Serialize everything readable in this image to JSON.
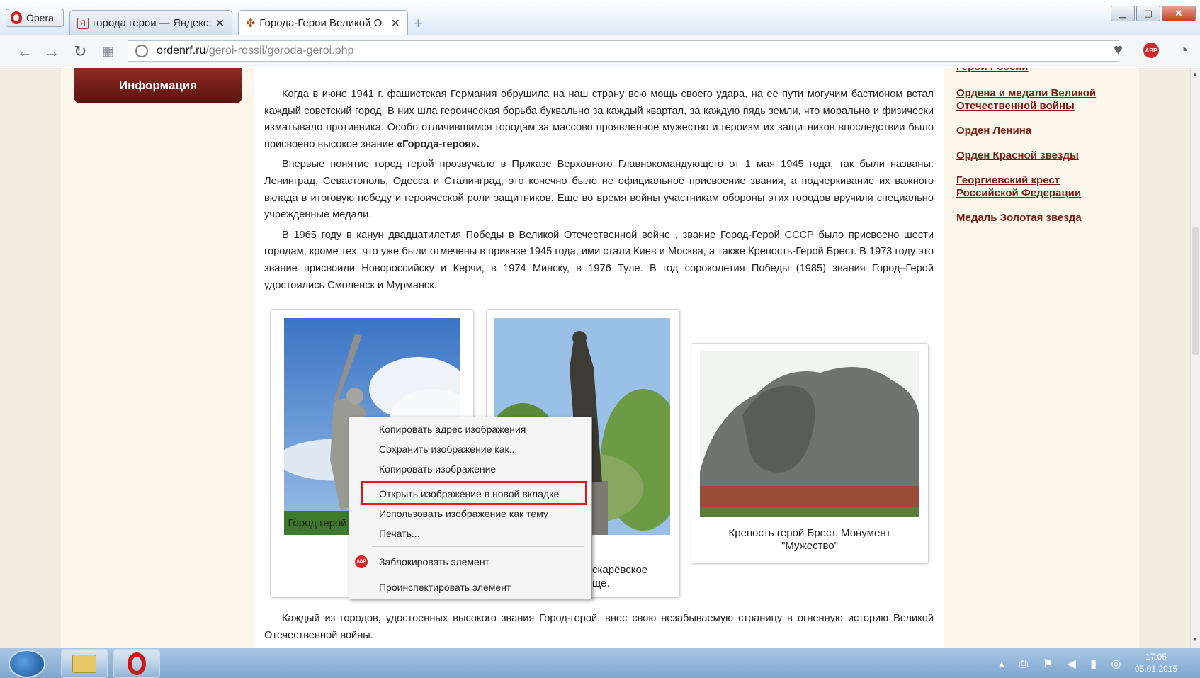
{
  "browser": {
    "menu_label": "Opera",
    "tabs": [
      {
        "title": "города герои — Яндекс: н",
        "favicon": "Я"
      },
      {
        "title": "Города-Герои Великой О"
      }
    ],
    "url_host": "ordenrf.ru",
    "url_path": "/geroi-rossii/goroda-geroi.php"
  },
  "page": {
    "info_button": "Информация",
    "paragraphs": [
      {
        "text": "Когда в июне 1941 г. фашистская Германия обрушила на наш страну всю мощь своего удара, на ее пути могучим бастионом встал каждый советский город. В них шла героическая борьба буквально за каждый квартал, за каждую пядь земли, что морально и физически изматывало противника. Особо отличившимся городам за массово проявленное мужество и героизм их защитников впоследствии было присвоено высокое звание ",
        "bold": "«Города-героя»."
      },
      {
        "text": "Впервые понятие город герой прозвучало в Приказе Верховного Главнокомандующего от 1 мая 1945 года, так были названы: Ленинград, Севастополь, Одесса и Сталинград, это конечно было не официальное присвоение звания, а подчеркивание их важного вклада в итоговую победу и героической роли защитников. Еще во время войны участникам обороны этих городов вручили специально учрежденные медали."
      },
      {
        "text": "В 1965 году в канун двадцатилетия Победы в Великой Отечественной войне , звание Город-Герой СССР было присвоено шести городам, кроме тех, что уже были отмечены в приказе 1945 года, ими стали Киев и Москва, а также Крепость-Герой Брест. В 1973 году это звание присвоили Новороссийску и Керчи, в 1974 Минску, в 1976 Туле. В год сороколетия Победы (1985) звания Город–Герой удостоились Смоленск и Мурманск."
      }
    ],
    "captions": {
      "photo1": "Город герой",
      "photo2_line1": "скарёвское",
      "photo2_line2": "ще.",
      "photo3": "Крепость герой Брест. Монумент \"Мужество\""
    },
    "bottom_paragraph": "Каждый из городов, удостоенных высокого звания Город-герой, внес свою незабываемую страницу в огненную историю Великой Отечественной войны."
  },
  "sidebar": {
    "links": [
      {
        "label": "Герои России"
      },
      {
        "label": "Ордена и медали Великой Отечественной войны"
      },
      {
        "label": "Орден Ленина"
      },
      {
        "label": "Орден Красной звезды"
      },
      {
        "label": "Георгиевский крест Российской Федерации"
      },
      {
        "label": "Медаль Золотая звезда"
      }
    ]
  },
  "context_menu": {
    "items": [
      "Копировать адрес изображения",
      "Сохранить изображение как...",
      "Копировать изображение",
      "Открыть изображение в новой вкладке",
      "Использовать изображение как тему",
      "Печать...",
      "Заблокировать элемент",
      "Проинспектировать элемент"
    ],
    "highlighted_index": 3,
    "abp_icon": "ABP"
  },
  "taskbar": {
    "time": "17:05",
    "date": "05.01.2015"
  },
  "colors": {
    "accent": "#7a1e14",
    "highlight": "#e0191e"
  }
}
